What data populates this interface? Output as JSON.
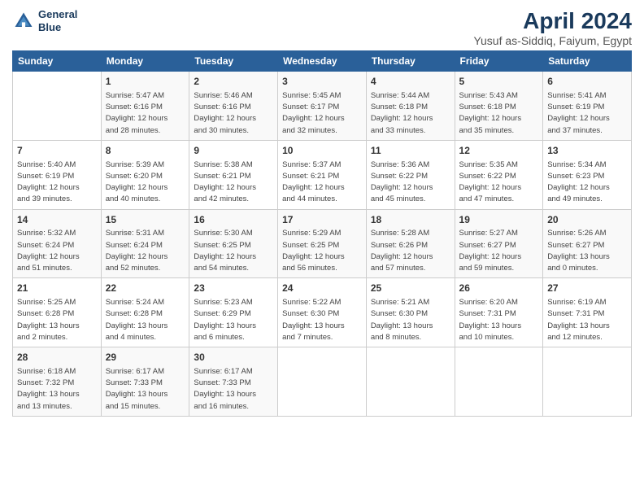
{
  "logo": {
    "line1": "General",
    "line2": "Blue"
  },
  "title": "April 2024",
  "subtitle": "Yusuf as-Siddiq, Faiyum, Egypt",
  "days_of_week": [
    "Sunday",
    "Monday",
    "Tuesday",
    "Wednesday",
    "Thursday",
    "Friday",
    "Saturday"
  ],
  "weeks": [
    [
      {
        "day": "",
        "sunrise": "",
        "sunset": "",
        "daylight": ""
      },
      {
        "day": "1",
        "sunrise": "Sunrise: 5:47 AM",
        "sunset": "Sunset: 6:16 PM",
        "daylight": "Daylight: 12 hours and 28 minutes."
      },
      {
        "day": "2",
        "sunrise": "Sunrise: 5:46 AM",
        "sunset": "Sunset: 6:16 PM",
        "daylight": "Daylight: 12 hours and 30 minutes."
      },
      {
        "day": "3",
        "sunrise": "Sunrise: 5:45 AM",
        "sunset": "Sunset: 6:17 PM",
        "daylight": "Daylight: 12 hours and 32 minutes."
      },
      {
        "day": "4",
        "sunrise": "Sunrise: 5:44 AM",
        "sunset": "Sunset: 6:18 PM",
        "daylight": "Daylight: 12 hours and 33 minutes."
      },
      {
        "day": "5",
        "sunrise": "Sunrise: 5:43 AM",
        "sunset": "Sunset: 6:18 PM",
        "daylight": "Daylight: 12 hours and 35 minutes."
      },
      {
        "day": "6",
        "sunrise": "Sunrise: 5:41 AM",
        "sunset": "Sunset: 6:19 PM",
        "daylight": "Daylight: 12 hours and 37 minutes."
      }
    ],
    [
      {
        "day": "7",
        "sunrise": "Sunrise: 5:40 AM",
        "sunset": "Sunset: 6:19 PM",
        "daylight": "Daylight: 12 hours and 39 minutes."
      },
      {
        "day": "8",
        "sunrise": "Sunrise: 5:39 AM",
        "sunset": "Sunset: 6:20 PM",
        "daylight": "Daylight: 12 hours and 40 minutes."
      },
      {
        "day": "9",
        "sunrise": "Sunrise: 5:38 AM",
        "sunset": "Sunset: 6:21 PM",
        "daylight": "Daylight: 12 hours and 42 minutes."
      },
      {
        "day": "10",
        "sunrise": "Sunrise: 5:37 AM",
        "sunset": "Sunset: 6:21 PM",
        "daylight": "Daylight: 12 hours and 44 minutes."
      },
      {
        "day": "11",
        "sunrise": "Sunrise: 5:36 AM",
        "sunset": "Sunset: 6:22 PM",
        "daylight": "Daylight: 12 hours and 45 minutes."
      },
      {
        "day": "12",
        "sunrise": "Sunrise: 5:35 AM",
        "sunset": "Sunset: 6:22 PM",
        "daylight": "Daylight: 12 hours and 47 minutes."
      },
      {
        "day": "13",
        "sunrise": "Sunrise: 5:34 AM",
        "sunset": "Sunset: 6:23 PM",
        "daylight": "Daylight: 12 hours and 49 minutes."
      }
    ],
    [
      {
        "day": "14",
        "sunrise": "Sunrise: 5:32 AM",
        "sunset": "Sunset: 6:24 PM",
        "daylight": "Daylight: 12 hours and 51 minutes."
      },
      {
        "day": "15",
        "sunrise": "Sunrise: 5:31 AM",
        "sunset": "Sunset: 6:24 PM",
        "daylight": "Daylight: 12 hours and 52 minutes."
      },
      {
        "day": "16",
        "sunrise": "Sunrise: 5:30 AM",
        "sunset": "Sunset: 6:25 PM",
        "daylight": "Daylight: 12 hours and 54 minutes."
      },
      {
        "day": "17",
        "sunrise": "Sunrise: 5:29 AM",
        "sunset": "Sunset: 6:25 PM",
        "daylight": "Daylight: 12 hours and 56 minutes."
      },
      {
        "day": "18",
        "sunrise": "Sunrise: 5:28 AM",
        "sunset": "Sunset: 6:26 PM",
        "daylight": "Daylight: 12 hours and 57 minutes."
      },
      {
        "day": "19",
        "sunrise": "Sunrise: 5:27 AM",
        "sunset": "Sunset: 6:27 PM",
        "daylight": "Daylight: 12 hours and 59 minutes."
      },
      {
        "day": "20",
        "sunrise": "Sunrise: 5:26 AM",
        "sunset": "Sunset: 6:27 PM",
        "daylight": "Daylight: 13 hours and 0 minutes."
      }
    ],
    [
      {
        "day": "21",
        "sunrise": "Sunrise: 5:25 AM",
        "sunset": "Sunset: 6:28 PM",
        "daylight": "Daylight: 13 hours and 2 minutes."
      },
      {
        "day": "22",
        "sunrise": "Sunrise: 5:24 AM",
        "sunset": "Sunset: 6:28 PM",
        "daylight": "Daylight: 13 hours and 4 minutes."
      },
      {
        "day": "23",
        "sunrise": "Sunrise: 5:23 AM",
        "sunset": "Sunset: 6:29 PM",
        "daylight": "Daylight: 13 hours and 6 minutes."
      },
      {
        "day": "24",
        "sunrise": "Sunrise: 5:22 AM",
        "sunset": "Sunset: 6:30 PM",
        "daylight": "Daylight: 13 hours and 7 minutes."
      },
      {
        "day": "25",
        "sunrise": "Sunrise: 5:21 AM",
        "sunset": "Sunset: 6:30 PM",
        "daylight": "Daylight: 13 hours and 8 minutes."
      },
      {
        "day": "26",
        "sunrise": "Sunrise: 6:20 AM",
        "sunset": "Sunset: 7:31 PM",
        "daylight": "Daylight: 13 hours and 10 minutes."
      },
      {
        "day": "27",
        "sunrise": "Sunrise: 6:19 AM",
        "sunset": "Sunset: 7:31 PM",
        "daylight": "Daylight: 13 hours and 12 minutes."
      }
    ],
    [
      {
        "day": "28",
        "sunrise": "Sunrise: 6:18 AM",
        "sunset": "Sunset: 7:32 PM",
        "daylight": "Daylight: 13 hours and 13 minutes."
      },
      {
        "day": "29",
        "sunrise": "Sunrise: 6:17 AM",
        "sunset": "Sunset: 7:33 PM",
        "daylight": "Daylight: 13 hours and 15 minutes."
      },
      {
        "day": "30",
        "sunrise": "Sunrise: 6:17 AM",
        "sunset": "Sunset: 7:33 PM",
        "daylight": "Daylight: 13 hours and 16 minutes."
      },
      {
        "day": "",
        "sunrise": "",
        "sunset": "",
        "daylight": ""
      },
      {
        "day": "",
        "sunrise": "",
        "sunset": "",
        "daylight": ""
      },
      {
        "day": "",
        "sunrise": "",
        "sunset": "",
        "daylight": ""
      },
      {
        "day": "",
        "sunrise": "",
        "sunset": "",
        "daylight": ""
      }
    ]
  ]
}
